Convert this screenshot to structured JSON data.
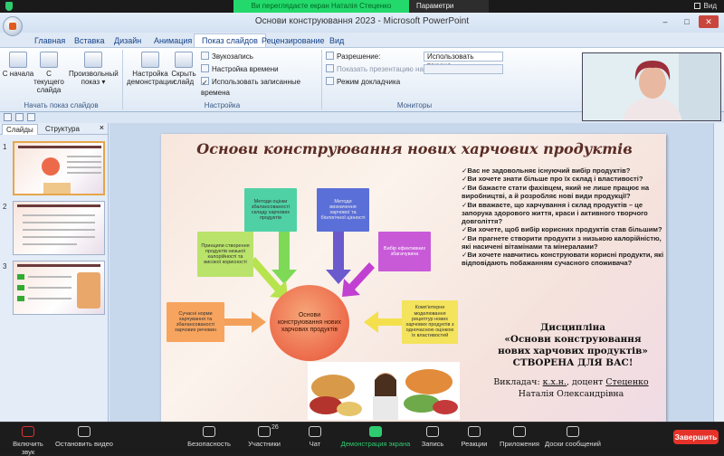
{
  "zoom": {
    "share_banner": "Ви переглядаєте екран Наталія Стеценко",
    "share_options": "Параметри перегляду",
    "view_label": "Вид",
    "bottom": {
      "mute": "Включить звук",
      "video": "Остановить видео",
      "security": "Безопасность",
      "participants": "Участники",
      "participants_count": "26",
      "chat": "Чат",
      "share": "Демонстрация экрана",
      "record": "Запись",
      "reactions": "Реакции",
      "apps": "Приложения",
      "whiteboards": "Доски сообщений",
      "end": "Завершить"
    }
  },
  "ppt": {
    "window_title": "Основи конструювання 2023 - Microsoft PowerPoint",
    "tabs": [
      "Главная",
      "Вставка",
      "Дизайн",
      "Анимация",
      "Показ слайдов",
      "Рецензирование",
      "Вид"
    ],
    "active_tab": "Показ слайдов",
    "ribbon": {
      "group1": {
        "label": "Начать показ слайдов",
        "btn1": "С начала",
        "btn2": "С текущего слайда",
        "btn3": "Произвольный показ"
      },
      "group2": {
        "label": "Настройка",
        "btn1": "Настройка демонстрации",
        "btn2": "Скрыть слайд",
        "item1": "Звукозапись",
        "item2": "Настройка времени",
        "item3": "Использовать записанные времена"
      },
      "group3": {
        "label": "Мониторы",
        "resolution_label": "Разрешение:",
        "resolution_value": "Использовать текуще...",
        "show_on_label": "Показать презентацию на:",
        "presenter_label": "Режим докладчика"
      }
    },
    "left_pane": {
      "tab_slides": "Слайды",
      "tab_outline": "Структура",
      "close": "×",
      "numbers": [
        "1",
        "2",
        "3"
      ]
    }
  },
  "slide": {
    "title": "Основи конструювання нових харчових продуктів",
    "center": "Основи конструювання нових харчових продуктів",
    "boxes": {
      "b1": "Методи оцінки збалансованості складу харчових продуктів",
      "b2": "Методи визначення харчової та біологічної цінності",
      "b3": "Вибір ефективних збагачувача",
      "b4": "Комп'ютерне моделювання рецептур нових харчових продуктів з одночасною оцінкою їх властивостей",
      "b5": "Сучасні норми харчування та збалансованості харчових речовин",
      "b6": "Принципи створення продуктів низької калорійності та високої корисності"
    },
    "bullets": [
      "✓Вас не задовольняє існуючий вибір продуктів?",
      "✓Ви хочете знати більше про їх склад і властивості?",
      "✓Ви бажаєте стати фахівцем, який не лише працює на виробництві, а й розробляє нові види продукції?",
      "✓Ви вважаєте, що харчування і склад продуктів – це запорука здорового життя, краси і активного творчого довголіття?",
      "✓Ви хочете, щоб вибір корисних продуктів став більшим?",
      "✓Ви прагнете створити продукти з низькою калорійністю, які насичені вітамінами та мінералами?",
      "✓Ви хочете навчитись конструювати корисні продукти, які відповідають побажанням сучасного споживача?"
    ],
    "discipline_line1": "Дисципліна",
    "discipline_line2": "«Основи конструювання нових харчових продуктів»",
    "discipline_line3": "СТВОРЕНА ДЛЯ ВАС!",
    "lecturer_prefix": "Викладач: ",
    "lecturer_degree": "к.х.н.",
    "lecturer_mid": ", доцент ",
    "lecturer_surname": "Стеценко",
    "lecturer_name": "Наталія Олександрівна"
  },
  "colors": {
    "zoom_green": "#23d96c",
    "end_red": "#e5332a",
    "title_brown": "#5a2c25",
    "circle_orange": "#ec6a4a"
  }
}
